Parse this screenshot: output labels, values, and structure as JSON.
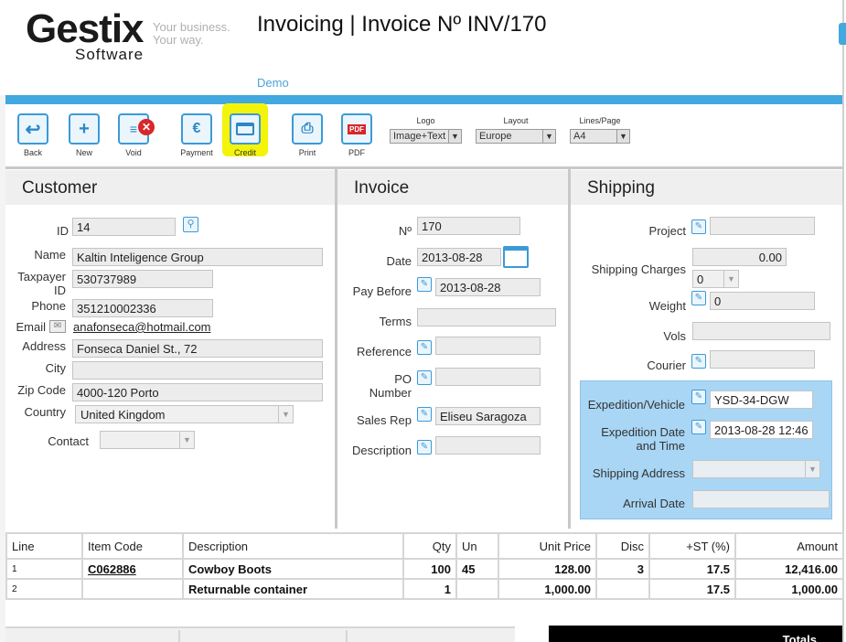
{
  "brand": {
    "name": "Gestix",
    "sub": "Software",
    "tagline_1": "Your business.",
    "tagline_2": "Your way."
  },
  "header": {
    "title": "Invoicing | Invoice Nº INV/170",
    "demo": "Demo"
  },
  "toolbar": {
    "back": "Back",
    "new": "New",
    "void": "Void",
    "payment": "Payment",
    "credit": "Credit",
    "print": "Print",
    "pdf": "PDF",
    "pdf_badge": "PDF",
    "logo_label": "Logo",
    "logo_value": "Image+Text",
    "layout_label": "Layout",
    "layout_value": "Europe",
    "lines_label": "Lines/Page",
    "lines_value": "A4"
  },
  "customer": {
    "heading": "Customer",
    "id_label": "ID",
    "id_value": "14",
    "name_label": "Name",
    "name_value": "Kaltin Inteligence Group",
    "taxpayer_label_1": "Taxpayer",
    "taxpayer_label_2": "ID",
    "taxpayer_value": "530737989",
    "phone_label": "Phone",
    "phone_value": "351210002336",
    "email_label": "Email",
    "email_value": "anafonseca@hotmail.com",
    "address_label": "Address",
    "address_value": "Fonseca Daniel St., 72",
    "city_label": "City",
    "city_value": "",
    "zip_label": "Zip Code",
    "zip_value": "4000-120 Porto",
    "country_label": "Country",
    "country_value": "United Kingdom",
    "contact_label": "Contact",
    "contact_value": ""
  },
  "invoice": {
    "heading": "Invoice",
    "no_label": "Nº",
    "no_value": "170",
    "date_label": "Date",
    "date_value": "2013-08-28",
    "paybefore_label": "Pay Before",
    "paybefore_value": "2013-08-28",
    "terms_label": "Terms",
    "terms_value": "",
    "reference_label": "Reference",
    "reference_value": "",
    "po_label_1": "PO",
    "po_label_2": "Number",
    "po_value": "",
    "salesrep_label": "Sales Rep",
    "salesrep_value": "Eliseu Saragoza",
    "description_label": "Description",
    "description_value": ""
  },
  "shipping": {
    "heading": "Shipping",
    "project_label": "Project",
    "project_value": "",
    "charges_label": "Shipping Charges",
    "charges_value": "0.00",
    "charges_tax": "0",
    "weight_label": "Weight",
    "weight_value": "0",
    "vols_label": "Vols",
    "vols_value": "",
    "courier_label": "Courier",
    "courier_value": "",
    "vehicle_label": "Expedition/Vehicle",
    "vehicle_value": "YSD-34-DGW",
    "expdate_label_1": "Expedition Date",
    "expdate_label_2": "and Time",
    "expdate_value": "2013-08-28 12:46",
    "address_label": "Shipping Address",
    "address_value": "",
    "arrival_label": "Arrival Date",
    "arrival_value": ""
  },
  "items": {
    "headers": [
      "Line",
      "Item Code",
      "Description",
      "Qty",
      "Un",
      "Unit Price",
      "Disc",
      "+ST (%)",
      "Amount"
    ],
    "rows": [
      {
        "line": "1",
        "code": "C062886",
        "desc": "Cowboy Boots",
        "qty": "100",
        "un": "45",
        "price": "128.00",
        "disc": "3",
        "st": "17.5",
        "amount": "12,416.00"
      },
      {
        "line": "2",
        "code": "",
        "desc": "Returnable container",
        "qty": "1",
        "un": "",
        "price": "1,000.00",
        "disc": "",
        "st": "17.5",
        "amount": "1,000.00"
      }
    ]
  },
  "footer": {
    "totals": "Totals"
  },
  "colors": {
    "accent": "#41a8e0",
    "highlight": "#f4f40a",
    "expedition_bg": "#a9d6f5"
  }
}
